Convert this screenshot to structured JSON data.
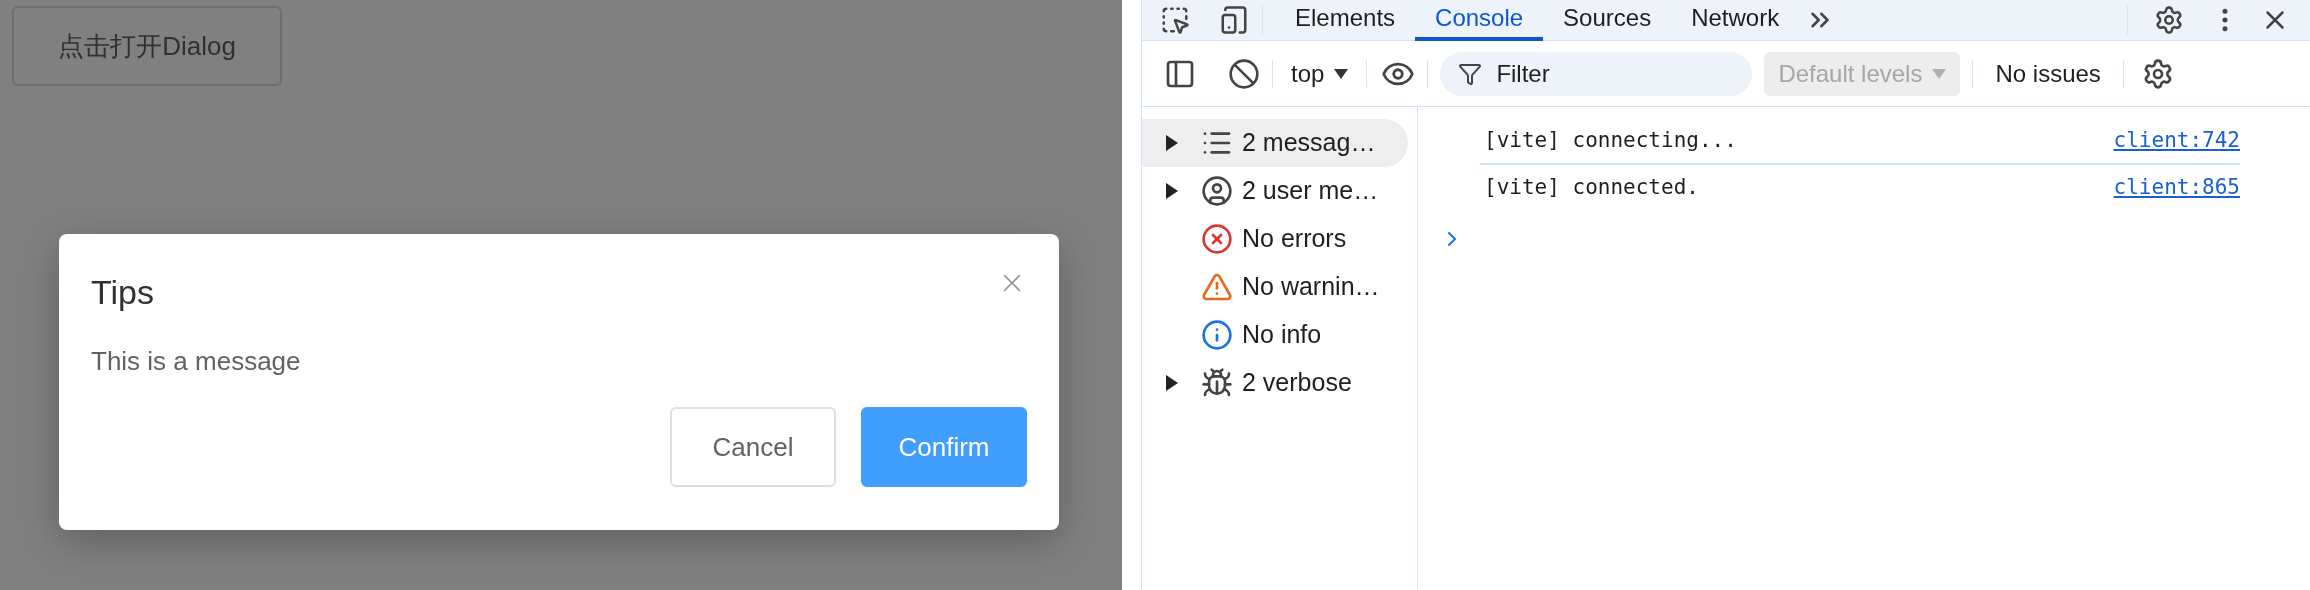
{
  "page": {
    "open_button": "点击打开Dialog"
  },
  "dialog": {
    "title": "Tips",
    "message": "This is a message",
    "buttons": [
      {
        "label": "Cancel",
        "kind": "default"
      },
      {
        "label": "Confirm",
        "kind": "primary"
      }
    ]
  },
  "devtools": {
    "tabs": [
      {
        "label": "Elements",
        "selected": false
      },
      {
        "label": "Console",
        "selected": true
      },
      {
        "label": "Sources",
        "selected": false
      },
      {
        "label": "Network",
        "selected": false
      }
    ],
    "toolbar": {
      "context": "top",
      "filter_placeholder": "Filter",
      "levels": "Default levels",
      "levels_disabled": true,
      "issues": "No issues"
    },
    "sidebar": {
      "items": [
        {
          "label": "2 messag…",
          "kind": "messages",
          "expandable": true,
          "selected": true
        },
        {
          "label": "2 user me…",
          "kind": "user",
          "expandable": true,
          "selected": false
        },
        {
          "label": "No errors",
          "kind": "errors",
          "expandable": false,
          "selected": false
        },
        {
          "label": "No warnin…",
          "kind": "warnings",
          "expandable": false,
          "selected": false
        },
        {
          "label": "No info",
          "kind": "info",
          "expandable": false,
          "selected": false
        },
        {
          "label": "2 verbose",
          "kind": "verbose",
          "expandable": true,
          "selected": false
        }
      ]
    },
    "console": {
      "messages": [
        {
          "text": "[vite] connecting...",
          "source": "client:742"
        },
        {
          "text": "[vite] connected.",
          "source": "client:865"
        }
      ]
    }
  }
}
